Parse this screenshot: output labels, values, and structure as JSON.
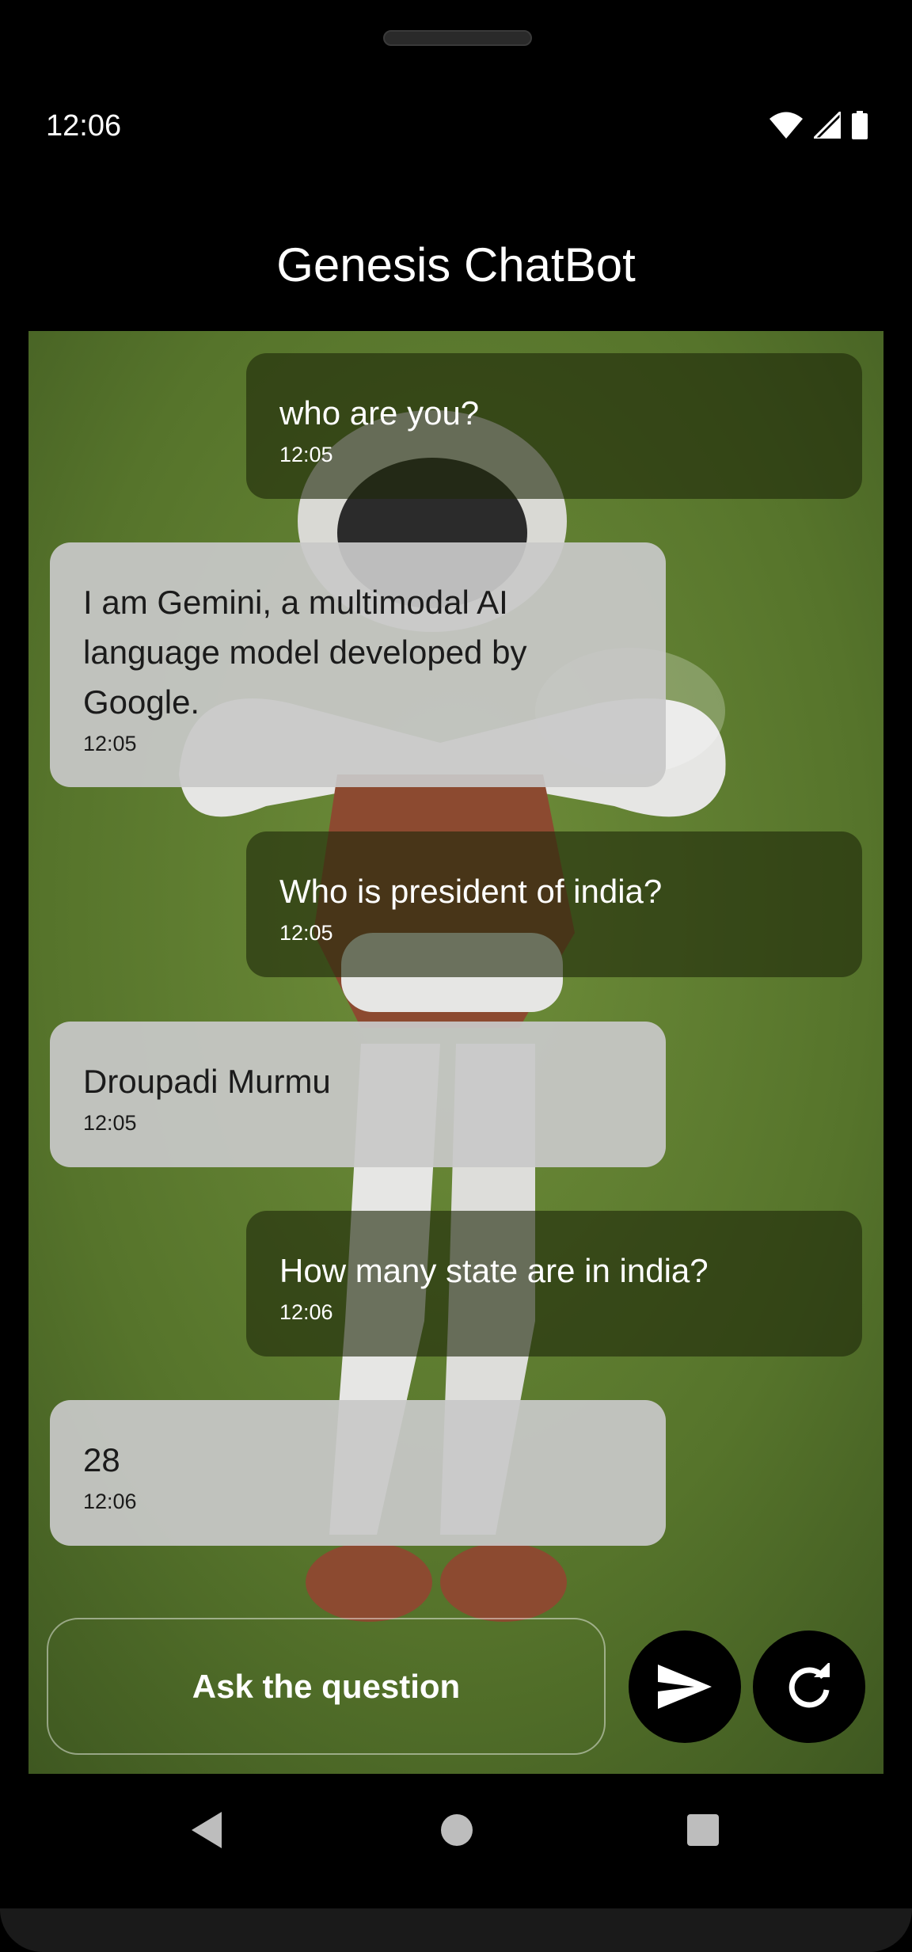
{
  "status_bar": {
    "time": "12:06"
  },
  "app": {
    "title": "Genesis ChatBot"
  },
  "messages": [
    {
      "role": "user",
      "text": "who are you?",
      "time": "12:05"
    },
    {
      "role": "bot",
      "text": "I am Gemini, a multimodal AI language model developed by Google.",
      "time": "12:05"
    },
    {
      "role": "user",
      "text": "Who is president of india?",
      "time": "12:05"
    },
    {
      "role": "bot",
      "text": "Droupadi Murmu",
      "time": "12:05"
    },
    {
      "role": "user",
      "text": "How many state are in india?",
      "time": "12:06"
    },
    {
      "role": "bot",
      "text": "28",
      "time": "12:06"
    }
  ],
  "input": {
    "placeholder": "Ask the question"
  },
  "icons": {
    "send": "send-icon",
    "refresh": "refresh-icon",
    "back": "back-icon",
    "home": "home-icon",
    "recents": "recents-icon"
  }
}
